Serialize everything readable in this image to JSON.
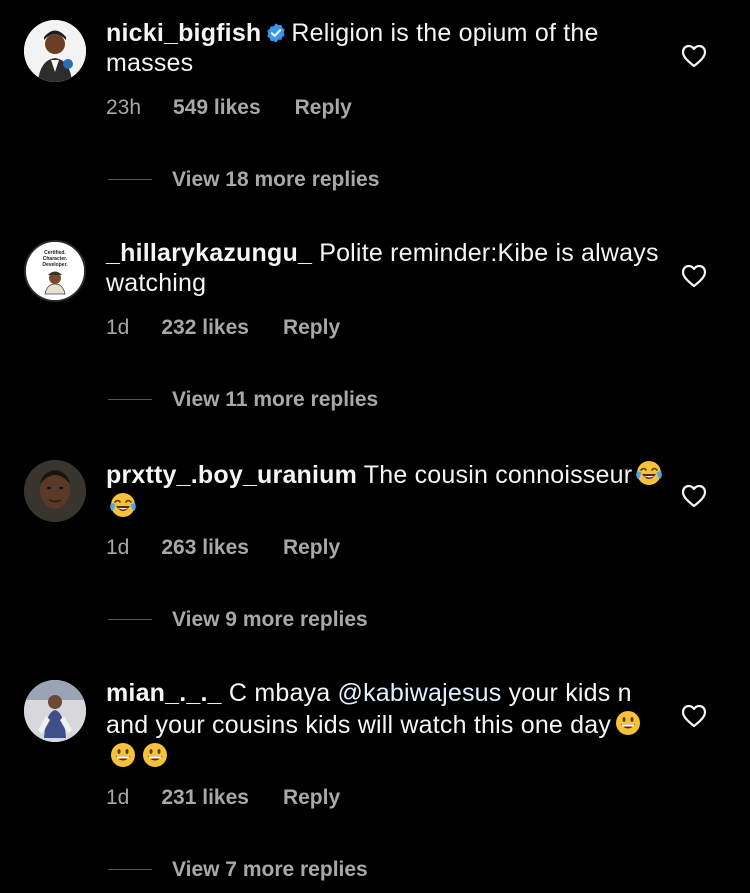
{
  "comments": [
    {
      "username": "nicki_bigfish",
      "verified": true,
      "text": "Religion is the opium of the masses",
      "time": "23h",
      "likes": "549 likes",
      "reply": "Reply",
      "view_replies": "View 18 more replies"
    },
    {
      "username": "_hillarykazungu_",
      "verified": false,
      "text": "Polite reminder:Kibe is always watching",
      "time": "1d",
      "likes": "232 likes",
      "reply": "Reply",
      "view_replies": "View 11 more replies",
      "avatar_text": "Certified. Character. Developer."
    },
    {
      "username": "prxtty_.boy_uranium",
      "verified": false,
      "text": "The cousin connoisseur",
      "emojis": [
        "face-with-tears-of-joy",
        "face-with-tears-of-joy"
      ],
      "time": "1d",
      "likes": "263 likes",
      "reply": "Reply",
      "view_replies": "View 9 more replies"
    },
    {
      "username": "mian_._._",
      "verified": false,
      "text_before": "C mbaya ",
      "mention": "@kabiwajesus",
      "text_after": " your kids n and your cousins kids will watch this one day",
      "emojis": [
        "grinning-face",
        "grinning-face",
        "grinning-face"
      ],
      "time": "1d",
      "likes": "231 likes",
      "reply": "Reply",
      "view_replies": "View 7 more replies"
    }
  ],
  "colors": {
    "background": "#000000",
    "primary_text": "#f5f5f5",
    "secondary_text": "#a8a8a8",
    "verified_badge": "#3897f0",
    "mention": "#e0f1ff"
  },
  "icons": {
    "like": "heart-outline-icon",
    "verified": "verified-badge-icon"
  }
}
